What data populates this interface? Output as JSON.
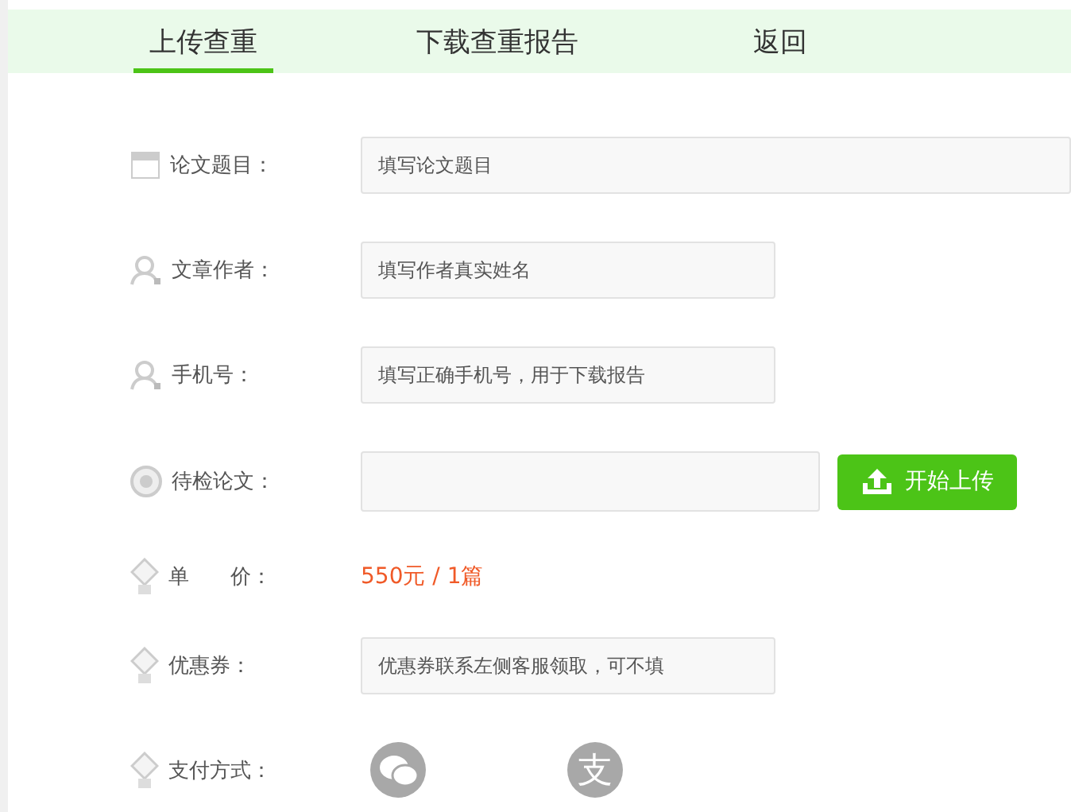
{
  "tabs": [
    {
      "label": "上传查重",
      "selected": true
    },
    {
      "label": "下载查重报告",
      "selected": false
    },
    {
      "label": "返回",
      "selected": false
    }
  ],
  "form": [
    {
      "kind": "text",
      "label": "论文题目：",
      "placeholder": "填写论文题目"
    },
    {
      "kind": "text",
      "label": "文章作者：",
      "placeholder": "填写作者真实姓名"
    },
    {
      "kind": "text",
      "label": "手机号：",
      "placeholder": "填写正确手机号，用于下载报告"
    },
    {
      "kind": "upload",
      "label": "待检论文：",
      "button": "开始上传"
    },
    {
      "kind": "price",
      "label": "单　　价：",
      "value": "550元 / 1篇"
    },
    {
      "kind": "text",
      "label": "优惠券：",
      "placeholder": "优惠券联系左侧客服领取，可不填"
    },
    {
      "kind": "payment",
      "label": "支付方式：",
      "methods": [
        {
          "kind": "wechat"
        },
        {
          "kind": "alipay",
          "glyph": "支"
        }
      ]
    }
  ]
}
